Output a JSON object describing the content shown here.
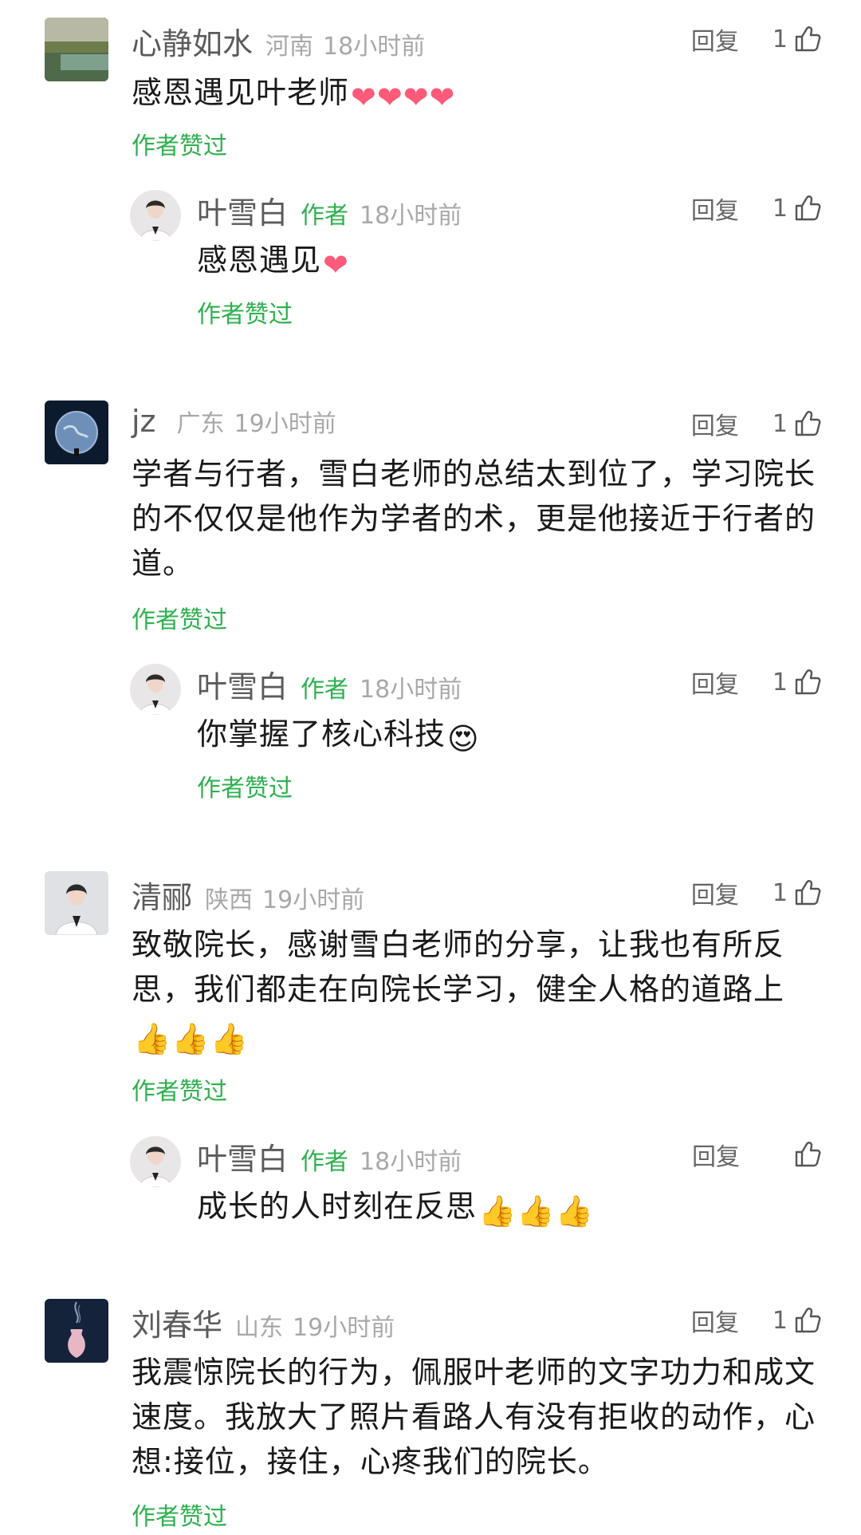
{
  "comments": [
    {
      "user": "心静如水",
      "region": "河南",
      "time": "18小时前",
      "text": "感恩遇见叶老师",
      "emojis": "❤❤❤❤",
      "liked_label": "作者赞过",
      "reply_label": "回复",
      "like_count": "1",
      "reply": {
        "user": "叶雪白",
        "author_tag": "作者",
        "time": "18小时前",
        "text": "感恩遇见",
        "emojis": "❤",
        "liked_label": "作者赞过",
        "reply_label": "回复",
        "like_count": "1"
      }
    },
    {
      "user": "jz",
      "region": "广东",
      "time": "19小时前",
      "text": "学者与行者，雪白老师的总结太到位了，学习院长的不仅仅是他作为学者的术，更是他接近于行者的道。",
      "liked_label": "作者赞过",
      "reply_label": "回复",
      "like_count": "1",
      "reply": {
        "user": "叶雪白",
        "author_tag": "作者",
        "time": "18小时前",
        "text": "你掌握了核心科技",
        "emojis": "😍",
        "liked_label": "作者赞过",
        "reply_label": "回复",
        "like_count": "1"
      }
    },
    {
      "user": "清郦",
      "region": "陕西",
      "time": "19小时前",
      "text": "致敬院长，感谢雪白老师的分享，让我也有所反思，我们都走在向院长学习，健全人格的道路上",
      "emojis": "👍👍👍",
      "liked_label": "作者赞过",
      "reply_label": "回复",
      "like_count": "1",
      "reply": {
        "user": "叶雪白",
        "author_tag": "作者",
        "time": "18小时前",
        "text": "成长的人时刻在反思",
        "emojis": "👍👍👍",
        "reply_label": "回复",
        "like_count": ""
      }
    },
    {
      "user": "刘春华",
      "region": "山东",
      "time": "19小时前",
      "text": "我震惊院长的行为，佩服叶老师的文字功力和成文速度。我放大了照片看路人有没有拒收的动作，心想:接位，接住，心疼我们的院长。",
      "liked_label": "作者赞过",
      "reply_label": "回复",
      "like_count": "1"
    }
  ],
  "colors": {
    "accent_green": "#2fb04f",
    "meta_gray": "#a8a8a8",
    "name_gray": "#5b5b5b",
    "heart": "#ff5a7a"
  },
  "icons": {
    "like": "thumbs-up-outline-icon"
  }
}
